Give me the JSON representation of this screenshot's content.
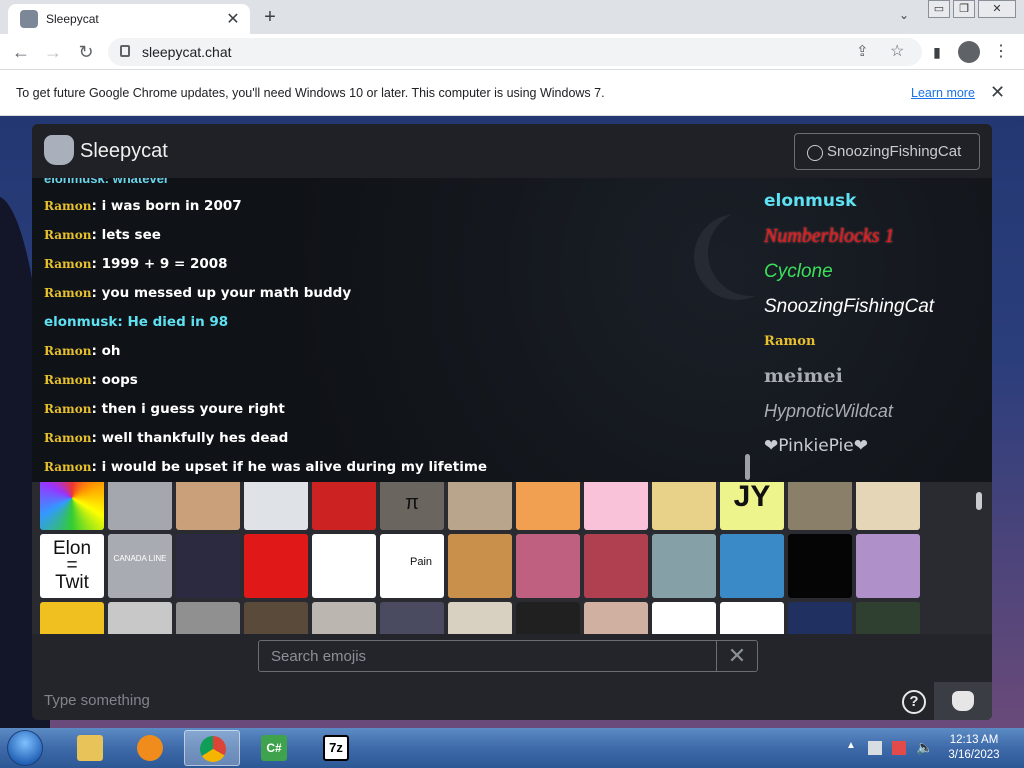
{
  "browser": {
    "tab_title": "Sleepycat",
    "tab_close": "✕",
    "new_tab": "+",
    "tab_search": "⌄",
    "url": "sleepycat.chat",
    "win_buttons": [
      "▭",
      "❐",
      "✕"
    ]
  },
  "infobar": {
    "message": "To get future Google Chrome updates, you'll need Windows 10 or later. This computer is using Windows 7.",
    "learn_more": "Learn more",
    "close": "✕"
  },
  "app": {
    "name": "Sleepycat",
    "username": "SnoozingFishingCat"
  },
  "chat": {
    "messages": [
      {
        "user": "Ramon",
        "text": "i was born in 2007"
      },
      {
        "user": "Ramon",
        "text": "lets see"
      },
      {
        "user": "Ramon",
        "text": "1999 + 9 = 2008"
      },
      {
        "user": "Ramon",
        "text": "you messed up your math buddy"
      },
      {
        "user": "elonmusk",
        "text": "He died in 98"
      },
      {
        "user": "Ramon",
        "text": "oh"
      },
      {
        "user": "Ramon",
        "text": "oops"
      },
      {
        "user": "Ramon",
        "text": "then i guess youre right"
      },
      {
        "user": "Ramon",
        "text": "well thankfully hes dead"
      },
      {
        "user": "Ramon",
        "text": "i would be upset if he was alive during my lifetime"
      }
    ],
    "users": [
      {
        "name": "elonmusk",
        "color": "#5ee1f2"
      },
      {
        "name": "Numberblocks 1",
        "color": "#e01b1b"
      },
      {
        "name": "Cyclone",
        "color": "#3be05a"
      },
      {
        "name": "SnoozingFishingCat",
        "color": "#ffffff"
      },
      {
        "name": "Ramon",
        "color": "#e7c02e"
      },
      {
        "name": "meimei",
        "color": "#a9acb2"
      },
      {
        "name": "HypnoticWildcat",
        "color": "#a9acb2"
      },
      {
        "name": "❤PinkiePie❤",
        "color": "#c9ccd1"
      }
    ]
  },
  "emoji_labels": {
    "elon": "Elon\n=\nTwit",
    "paint": "Pain",
    "jy": "JY",
    "canada": "CANADA LINE",
    "pi": "π"
  },
  "emoji_search": {
    "placeholder": "Search emojis",
    "clear": "✕"
  },
  "composer": {
    "placeholder": "Type something",
    "help": "?"
  },
  "taskbar": {
    "time": "12:13 AM",
    "date": "3/16/2023",
    "apps": [
      "folder",
      "media",
      "chrome",
      "csharp",
      "7z"
    ],
    "csharp_label": "C#",
    "sevenzip_label": "7z"
  }
}
